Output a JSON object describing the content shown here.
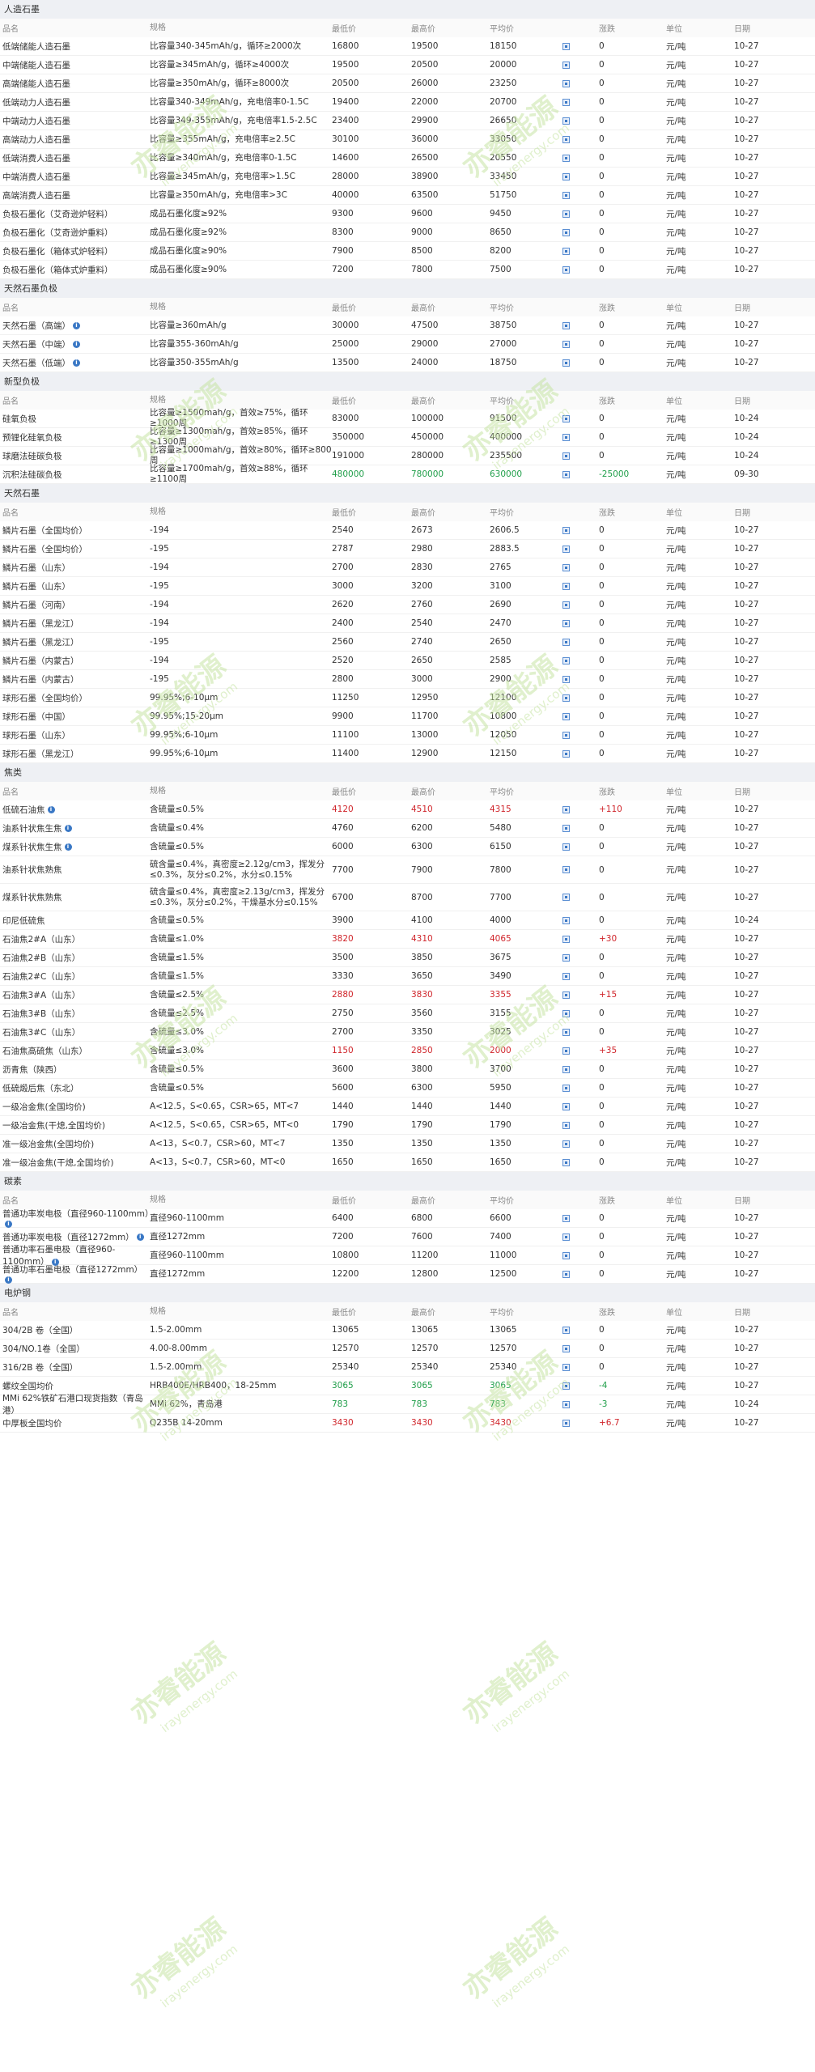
{
  "headers": {
    "name": "品名",
    "spec": "规格",
    "min": "最低价",
    "max": "最高价",
    "avg": "平均价",
    "chg": "涨跌",
    "unit": "单位",
    "date": "日期"
  },
  "colors": {
    "up": "#d0252b",
    "down": "#1f9e49",
    "section_bg": "#eef0f4",
    "watermark": "#c7e5a5"
  },
  "watermark": {
    "text": "亦睿能源",
    "sub": "irayenergy.com"
  },
  "sections": [
    {
      "title": "人造石墨",
      "rows": [
        {
          "name": "低端储能人造石墨",
          "spec": "比容量340-345mAh/g，循环≥2000次",
          "min": "16800",
          "max": "19500",
          "avg": "18150",
          "chg": "0",
          "unit": "元/吨",
          "date": "10-27"
        },
        {
          "name": "中端储能人造石墨",
          "spec": "比容量≥345mAh/g，循环≥4000次",
          "min": "19500",
          "max": "20500",
          "avg": "20000",
          "chg": "0",
          "unit": "元/吨",
          "date": "10-27"
        },
        {
          "name": "高端储能人造石墨",
          "spec": "比容量≥350mAh/g，循环≥8000次",
          "min": "20500",
          "max": "26000",
          "avg": "23250",
          "chg": "0",
          "unit": "元/吨",
          "date": "10-27"
        },
        {
          "name": "低端动力人造石墨",
          "spec": "比容量340-349mAh/g，充电倍率0-1.5C",
          "min": "19400",
          "max": "22000",
          "avg": "20700",
          "chg": "0",
          "unit": "元/吨",
          "date": "10-27"
        },
        {
          "name": "中端动力人造石墨",
          "spec": "比容量349-355mAh/g，充电倍率1.5-2.5C",
          "min": "23400",
          "max": "29900",
          "avg": "26650",
          "chg": "0",
          "unit": "元/吨",
          "date": "10-27"
        },
        {
          "name": "高端动力人造石墨",
          "spec": "比容量≥355mAh/g，充电倍率≥2.5C",
          "min": "30100",
          "max": "36000",
          "avg": "33050",
          "chg": "0",
          "unit": "元/吨",
          "date": "10-27"
        },
        {
          "name": "低端消费人造石墨",
          "spec": "比容量≥340mAh/g，充电倍率0-1.5C",
          "min": "14600",
          "max": "26500",
          "avg": "20550",
          "chg": "0",
          "unit": "元/吨",
          "date": "10-27"
        },
        {
          "name": "中端消费人造石墨",
          "spec": "比容量≥345mAh/g，充电倍率>1.5C",
          "min": "28000",
          "max": "38900",
          "avg": "33450",
          "chg": "0",
          "unit": "元/吨",
          "date": "10-27"
        },
        {
          "name": "高端消费人造石墨",
          "spec": "比容量≥350mAh/g，充电倍率>3C",
          "min": "40000",
          "max": "63500",
          "avg": "51750",
          "chg": "0",
          "unit": "元/吨",
          "date": "10-27"
        },
        {
          "name": "负极石墨化（艾奇逊炉轻料）",
          "spec": "成品石墨化度≥92%",
          "min": "9300",
          "max": "9600",
          "avg": "9450",
          "chg": "0",
          "unit": "元/吨",
          "date": "10-27"
        },
        {
          "name": "负极石墨化（艾奇逊炉重料）",
          "spec": "成品石墨化度≥92%",
          "min": "8300",
          "max": "9000",
          "avg": "8650",
          "chg": "0",
          "unit": "元/吨",
          "date": "10-27"
        },
        {
          "name": "负极石墨化（箱体式炉轻料）",
          "spec": "成品石墨化度≥90%",
          "min": "7900",
          "max": "8500",
          "avg": "8200",
          "chg": "0",
          "unit": "元/吨",
          "date": "10-27"
        },
        {
          "name": "负极石墨化（箱体式炉重料）",
          "spec": "成品石墨化度≥90%",
          "min": "7200",
          "max": "7800",
          "avg": "7500",
          "chg": "0",
          "unit": "元/吨",
          "date": "10-27"
        }
      ]
    },
    {
      "title": "天然石墨负极",
      "rows": [
        {
          "name": "天然石墨（高端）",
          "info": true,
          "spec": "比容量≥360mAh/g",
          "min": "30000",
          "max": "47500",
          "avg": "38750",
          "chg": "0",
          "unit": "元/吨",
          "date": "10-27"
        },
        {
          "name": "天然石墨（中端）",
          "info": true,
          "spec": "比容量355-360mAh/g",
          "min": "25000",
          "max": "29000",
          "avg": "27000",
          "chg": "0",
          "unit": "元/吨",
          "date": "10-27"
        },
        {
          "name": "天然石墨（低端）",
          "info": true,
          "spec": "比容量350-355mAh/g",
          "min": "13500",
          "max": "24000",
          "avg": "18750",
          "chg": "0",
          "unit": "元/吨",
          "date": "10-27"
        }
      ]
    },
    {
      "title": "新型负极",
      "rows": [
        {
          "name": "硅氧负极",
          "spec": "比容量≥1500mah/g，首效≥75%，循环≥1000周",
          "min": "83000",
          "max": "100000",
          "avg": "91500",
          "chg": "0",
          "unit": "元/吨",
          "date": "10-24"
        },
        {
          "name": "预锂化硅氧负极",
          "spec": "比容量≥1300mah/g，首效≥85%，循环≥1300周",
          "min": "350000",
          "max": "450000",
          "avg": "400000",
          "chg": "0",
          "unit": "元/吨",
          "date": "10-24"
        },
        {
          "name": "球磨法硅碳负极",
          "spec": "比容量≥1000mah/g，首效≥80%，循环≥800周",
          "min": "191000",
          "max": "280000",
          "avg": "235500",
          "chg": "0",
          "unit": "元/吨",
          "date": "10-24"
        },
        {
          "name": "沉积法硅碳负极",
          "spec": "比容量≥1700mah/g，首效≥88%，循环≥1100周",
          "min": "480000",
          "max": "780000",
          "avg": "630000",
          "chg": "-25000",
          "trend": "down",
          "unit": "元/吨",
          "date": "09-30"
        }
      ]
    },
    {
      "title": "天然石墨",
      "rows": [
        {
          "name": "鳞片石墨（全国均价）",
          "spec": "-194",
          "min": "2540",
          "max": "2673",
          "avg": "2606.5",
          "chg": "0",
          "unit": "元/吨",
          "date": "10-27"
        },
        {
          "name": "鳞片石墨（全国均价）",
          "spec": "-195",
          "min": "2787",
          "max": "2980",
          "avg": "2883.5",
          "chg": "0",
          "unit": "元/吨",
          "date": "10-27"
        },
        {
          "name": "鳞片石墨（山东）",
          "spec": "-194",
          "min": "2700",
          "max": "2830",
          "avg": "2765",
          "chg": "0",
          "unit": "元/吨",
          "date": "10-27"
        },
        {
          "name": "鳞片石墨（山东）",
          "spec": "-195",
          "min": "3000",
          "max": "3200",
          "avg": "3100",
          "chg": "0",
          "unit": "元/吨",
          "date": "10-27"
        },
        {
          "name": "鳞片石墨（河南）",
          "spec": "-194",
          "min": "2620",
          "max": "2760",
          "avg": "2690",
          "chg": "0",
          "unit": "元/吨",
          "date": "10-27"
        },
        {
          "name": "鳞片石墨（黑龙江）",
          "spec": "-194",
          "min": "2400",
          "max": "2540",
          "avg": "2470",
          "chg": "0",
          "unit": "元/吨",
          "date": "10-27"
        },
        {
          "name": "鳞片石墨（黑龙江）",
          "spec": "-195",
          "min": "2560",
          "max": "2740",
          "avg": "2650",
          "chg": "0",
          "unit": "元/吨",
          "date": "10-27"
        },
        {
          "name": "鳞片石墨（内蒙古）",
          "spec": "-194",
          "min": "2520",
          "max": "2650",
          "avg": "2585",
          "chg": "0",
          "unit": "元/吨",
          "date": "10-27"
        },
        {
          "name": "鳞片石墨（内蒙古）",
          "spec": "-195",
          "min": "2800",
          "max": "3000",
          "avg": "2900",
          "chg": "0",
          "unit": "元/吨",
          "date": "10-27"
        },
        {
          "name": "球形石墨（全国均价）",
          "spec": "99.95%;6-10μm",
          "min": "11250",
          "max": "12950",
          "avg": "12100",
          "chg": "0",
          "unit": "元/吨",
          "date": "10-27"
        },
        {
          "name": "球形石墨（中国）",
          "spec": "99.95%;15-20μm",
          "min": "9900",
          "max": "11700",
          "avg": "10800",
          "chg": "0",
          "unit": "元/吨",
          "date": "10-27"
        },
        {
          "name": "球形石墨（山东）",
          "spec": "99.95%;6-10μm",
          "min": "11100",
          "max": "13000",
          "avg": "12050",
          "chg": "0",
          "unit": "元/吨",
          "date": "10-27"
        },
        {
          "name": "球形石墨（黑龙江）",
          "spec": "99.95%;6-10μm",
          "min": "11400",
          "max": "12900",
          "avg": "12150",
          "chg": "0",
          "unit": "元/吨",
          "date": "10-27"
        }
      ]
    },
    {
      "title": "焦类",
      "rows": [
        {
          "name": "低硫石油焦",
          "info": true,
          "spec": "含硫量≤0.5%",
          "min": "4120",
          "max": "4510",
          "avg": "4315",
          "chg": "+110",
          "trend": "up",
          "unit": "元/吨",
          "date": "10-27"
        },
        {
          "name": "油系针状焦生焦",
          "info": true,
          "spec": "含硫量≤0.4%",
          "min": "4760",
          "max": "6200",
          "avg": "5480",
          "chg": "0",
          "unit": "元/吨",
          "date": "10-27"
        },
        {
          "name": "煤系针状焦生焦",
          "info": true,
          "spec": "含硫量≤0.5%",
          "min": "6000",
          "max": "6300",
          "avg": "6150",
          "chg": "0",
          "unit": "元/吨",
          "date": "10-27"
        },
        {
          "name": "油系针状焦熟焦",
          "spec": "硫含量≤0.4%，真密度≥2.12g/cm3，挥发分≤0.3%，灰分≤0.2%，水分≤0.15%",
          "min": "7700",
          "max": "7900",
          "avg": "7800",
          "chg": "0",
          "unit": "元/吨",
          "date": "10-27"
        },
        {
          "name": "煤系针状焦熟焦",
          "spec": "硫含量≤0.4%，真密度≥2.13g/cm3，挥发分≤0.3%，灰分≤0.2%，干燥基水分≤0.15%",
          "min": "6700",
          "max": "8700",
          "avg": "7700",
          "chg": "0",
          "unit": "元/吨",
          "date": "10-27"
        },
        {
          "name": "印尼低硫焦",
          "spec": "含硫量≤0.5%",
          "min": "3900",
          "max": "4100",
          "avg": "4000",
          "chg": "0",
          "unit": "元/吨",
          "date": "10-24"
        },
        {
          "name": "石油焦2#A（山东）",
          "spec": "含硫量≤1.0%",
          "min": "3820",
          "max": "4310",
          "avg": "4065",
          "chg": "+30",
          "trend": "up",
          "unit": "元/吨",
          "date": "10-27"
        },
        {
          "name": "石油焦2#B（山东）",
          "spec": "含硫量≤1.5%",
          "min": "3500",
          "max": "3850",
          "avg": "3675",
          "chg": "0",
          "unit": "元/吨",
          "date": "10-27"
        },
        {
          "name": "石油焦2#C（山东）",
          "spec": "含硫量≤1.5%",
          "min": "3330",
          "max": "3650",
          "avg": "3490",
          "chg": "0",
          "unit": "元/吨",
          "date": "10-27"
        },
        {
          "name": "石油焦3#A（山东）",
          "spec": "含硫量≤2.5%",
          "min": "2880",
          "max": "3830",
          "avg": "3355",
          "chg": "+15",
          "trend": "up",
          "unit": "元/吨",
          "date": "10-27"
        },
        {
          "name": "石油焦3#B（山东）",
          "spec": "含硫量≤2.5%",
          "min": "2750",
          "max": "3560",
          "avg": "3155",
          "chg": "0",
          "unit": "元/吨",
          "date": "10-27"
        },
        {
          "name": "石油焦3#C（山东）",
          "spec": "含硫量≤3.0%",
          "min": "2700",
          "max": "3350",
          "avg": "3025",
          "chg": "0",
          "unit": "元/吨",
          "date": "10-27"
        },
        {
          "name": "石油焦高硫焦（山东）",
          "spec": "含硫量≤3.0%",
          "min": "1150",
          "max": "2850",
          "avg": "2000",
          "chg": "+35",
          "trend": "up",
          "unit": "元/吨",
          "date": "10-27"
        },
        {
          "name": "沥青焦（陕西）",
          "spec": "含硫量≤0.5%",
          "min": "3600",
          "max": "3800",
          "avg": "3700",
          "chg": "0",
          "unit": "元/吨",
          "date": "10-27"
        },
        {
          "name": "低硫煅后焦（东北）",
          "spec": "含硫量≤0.5%",
          "min": "5600",
          "max": "6300",
          "avg": "5950",
          "chg": "0",
          "unit": "元/吨",
          "date": "10-27"
        },
        {
          "name": "一级冶金焦(全国均价)",
          "spec": "A<12.5，S<0.65，CSR>65，MT<7",
          "min": "1440",
          "max": "1440",
          "avg": "1440",
          "chg": "0",
          "unit": "元/吨",
          "date": "10-27"
        },
        {
          "name": "一级冶金焦(干熄,全国均价)",
          "spec": "A<12.5，S<0.65，CSR>65，MT<0",
          "min": "1790",
          "max": "1790",
          "avg": "1790",
          "chg": "0",
          "unit": "元/吨",
          "date": "10-27"
        },
        {
          "name": "准一级冶金焦(全国均价)",
          "spec": "A<13，S<0.7，CSR>60，MT<7",
          "min": "1350",
          "max": "1350",
          "avg": "1350",
          "chg": "0",
          "unit": "元/吨",
          "date": "10-27"
        },
        {
          "name": "准一级冶金焦(干熄,全国均价)",
          "spec": "A<13，S<0.7，CSR>60，MT<0",
          "min": "1650",
          "max": "1650",
          "avg": "1650",
          "chg": "0",
          "unit": "元/吨",
          "date": "10-27"
        }
      ]
    },
    {
      "title": "碳素",
      "rows": [
        {
          "name": "普通功率炭电极（直径960-1100mm）",
          "info": true,
          "spec": "直径960-1100mm",
          "min": "6400",
          "max": "6800",
          "avg": "6600",
          "chg": "0",
          "unit": "元/吨",
          "date": "10-27"
        },
        {
          "name": "普通功率炭电极（直径1272mm）",
          "info": true,
          "spec": "直径1272mm",
          "min": "7200",
          "max": "7600",
          "avg": "7400",
          "chg": "0",
          "unit": "元/吨",
          "date": "10-27"
        },
        {
          "name": "普通功率石墨电极（直径960-1100mm）",
          "info": true,
          "spec": "直径960-1100mm",
          "min": "10800",
          "max": "11200",
          "avg": "11000",
          "chg": "0",
          "unit": "元/吨",
          "date": "10-27"
        },
        {
          "name": "普通功率石墨电极（直径1272mm）",
          "info": true,
          "spec": "直径1272mm",
          "min": "12200",
          "max": "12800",
          "avg": "12500",
          "chg": "0",
          "unit": "元/吨",
          "date": "10-27"
        }
      ]
    },
    {
      "title": "电炉钢",
      "rows": [
        {
          "name": "304/2B 卷（全国）",
          "spec": "1.5-2.00mm",
          "min": "13065",
          "max": "13065",
          "avg": "13065",
          "chg": "0",
          "unit": "元/吨",
          "date": "10-27"
        },
        {
          "name": "304/NO.1卷（全国）",
          "spec": "4.00-8.00mm",
          "min": "12570",
          "max": "12570",
          "avg": "12570",
          "chg": "0",
          "unit": "元/吨",
          "date": "10-27"
        },
        {
          "name": "316/2B 卷（全国）",
          "spec": "1.5-2.00mm",
          "min": "25340",
          "max": "25340",
          "avg": "25340",
          "chg": "0",
          "unit": "元/吨",
          "date": "10-27"
        },
        {
          "name": "螺纹全国均价",
          "spec": "HRB400E/HRB400，18-25mm",
          "min": "3065",
          "max": "3065",
          "avg": "3065",
          "chg": "-4",
          "trend": "down",
          "unit": "元/吨",
          "date": "10-27"
        },
        {
          "name": "MMi 62%铁矿石港口现货指数（青岛港）",
          "spec": "MMi 62%，青岛港",
          "min": "783",
          "max": "783",
          "avg": "783",
          "chg": "-3",
          "trend": "down",
          "unit": "元/吨",
          "date": "10-24"
        },
        {
          "name": "中厚板全国均价",
          "spec": "Q235B 14-20mm",
          "min": "3430",
          "max": "3430",
          "avg": "3430",
          "chg": "+6.7",
          "trend": "up",
          "unit": "元/吨",
          "date": "10-27"
        }
      ]
    }
  ]
}
